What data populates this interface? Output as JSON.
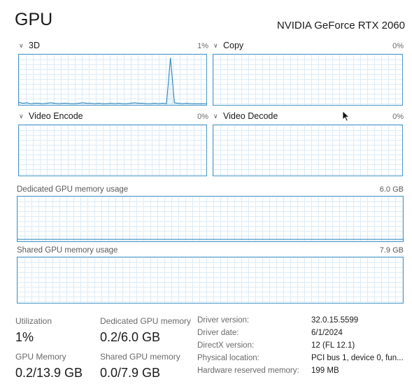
{
  "header": {
    "title": "GPU",
    "device_name": "NVIDIA GeForce RTX 2060"
  },
  "graphs": [
    {
      "label": "3D",
      "percent": "1%",
      "samples": [
        4,
        2,
        3,
        1,
        2,
        2,
        1,
        2,
        3,
        2,
        1,
        2,
        2,
        1,
        1,
        2,
        3,
        2,
        2,
        1,
        2,
        1,
        1,
        2,
        1,
        2,
        1,
        1,
        2,
        3,
        2,
        2,
        1,
        1,
        2,
        1,
        2,
        1,
        95,
        3,
        2,
        1,
        2,
        1,
        1,
        1,
        1,
        1
      ]
    },
    {
      "label": "Copy",
      "percent": "0%",
      "samples": []
    },
    {
      "label": "Video Encode",
      "percent": "0%",
      "samples": []
    },
    {
      "label": "Video Decode",
      "percent": "0%",
      "samples": []
    }
  ],
  "memory_graphs": [
    {
      "label": "Dedicated GPU memory usage",
      "max": "6.0 GB",
      "level_fraction": 0.03
    },
    {
      "label": "Shared GPU memory usage",
      "max": "7.9 GB",
      "level_fraction": 0.0
    }
  ],
  "stats": {
    "utilization": {
      "label": "Utilization",
      "value": "1%"
    },
    "dedicated": {
      "label": "Dedicated GPU memory",
      "value": "0.2/6.0 GB"
    },
    "gpu_memory": {
      "label": "GPU Memory",
      "value": "0.2/13.9 GB"
    },
    "shared": {
      "label": "Shared GPU memory",
      "value": "0.0/7.9 GB"
    }
  },
  "details": [
    {
      "label": "Driver version:",
      "value": "32.0.15.5599"
    },
    {
      "label": "Driver date:",
      "value": "6/1/2024"
    },
    {
      "label": "DirectX version:",
      "value": "12 (FL 12.1)"
    },
    {
      "label": "Physical location:",
      "value": "PCI bus 1, device 0, fun..."
    },
    {
      "label": "Hardware reserved memory:",
      "value": "199 MB"
    }
  ],
  "colors": {
    "graph_border": "#4a98c9",
    "grid": "#dcebf5",
    "line": "#1f7fb8"
  },
  "icons": {
    "collapse": "chevron-down-icon",
    "pointer": "mouse-cursor-icon"
  }
}
